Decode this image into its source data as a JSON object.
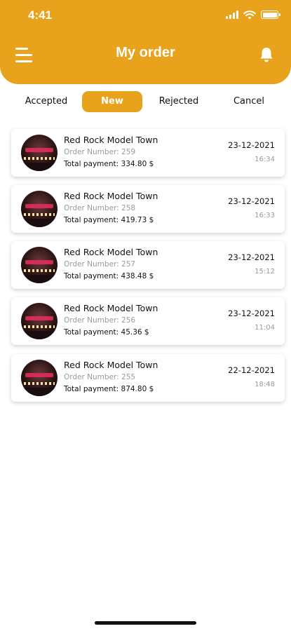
{
  "status_bar": {
    "time": "4:41"
  },
  "header": {
    "title": "My order",
    "accent_color": "#E8A21B"
  },
  "tabs": [
    {
      "label": "Accepted",
      "active": false
    },
    {
      "label": "New",
      "active": true
    },
    {
      "label": "Rejected",
      "active": false
    },
    {
      "label": "Cancel",
      "active": false
    }
  ],
  "orders": [
    {
      "store": "Red Rock Model Town",
      "order_number": "Order Number: 259",
      "total": "Total payment: 334.80 $",
      "date": "23-12-2021",
      "time": "16:34"
    },
    {
      "store": "Red Rock Model Town",
      "order_number": "Order Number: 258",
      "total": "Total payment: 419.73 $",
      "date": "23-12-2021",
      "time": "16:33"
    },
    {
      "store": "Red Rock Model Town",
      "order_number": "Order Number: 257",
      "total": "Total payment: 438.48 $",
      "date": "23-12-2021",
      "time": "15:12"
    },
    {
      "store": "Red Rock Model Town",
      "order_number": "Order Number: 256",
      "total": "Total payment: 45.36 $",
      "date": "23-12-2021",
      "time": "11:04"
    },
    {
      "store": "Red Rock Model Town",
      "order_number": "Order Number: 255",
      "total": "Total payment: 874.80 $",
      "date": "22-12-2021",
      "time": "18:48"
    }
  ]
}
